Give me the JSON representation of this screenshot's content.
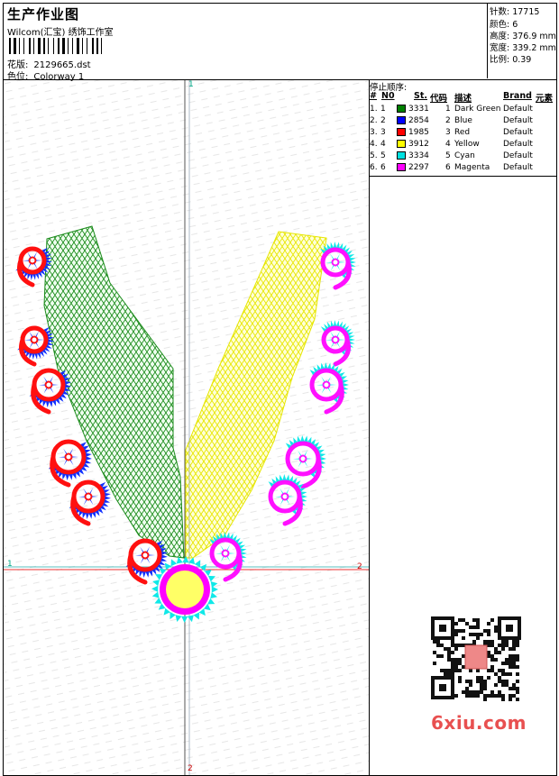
{
  "header": {
    "title": "生产作业图",
    "subtitle": "Wilcom(汇宝) 绣饰工作室",
    "design_label": "花版:",
    "design_value": "2129665.dst",
    "colorway_label": "色位:",
    "colorway_value": "Colorway 1"
  },
  "stats": {
    "stitches_label": "针数:",
    "stitches_value": "17715",
    "colors_label": "颜色:",
    "colors_value": "6",
    "height_label": "高度:",
    "height_value": "376.9 mm",
    "width_label": "宽度:",
    "width_value": "339.2 mm",
    "scale_label": "比例:",
    "scale_value": "0.39"
  },
  "color_table": {
    "title": "停止顺序:",
    "headers": {
      "num": "#",
      "no": "N0",
      "st": "St.",
      "code": "代码",
      "desc": "描述",
      "brand": "Brand",
      "elem": "元素"
    },
    "rows": [
      {
        "num": "1.",
        "no": "1",
        "st": "3331",
        "code": "1",
        "desc": "Dark Green",
        "brand": "Default",
        "color": "#008000"
      },
      {
        "num": "2.",
        "no": "2",
        "st": "2854",
        "code": "2",
        "desc": "Blue",
        "brand": "Default",
        "color": "#0000ff"
      },
      {
        "num": "3.",
        "no": "3",
        "st": "1985",
        "code": "3",
        "desc": "Red",
        "brand": "Default",
        "color": "#ff0000"
      },
      {
        "num": "4.",
        "no": "4",
        "st": "3912",
        "code": "4",
        "desc": "Yellow",
        "brand": "Default",
        "color": "#ffff00"
      },
      {
        "num": "5.",
        "no": "5",
        "st": "3334",
        "code": "5",
        "desc": "Cyan",
        "brand": "Default",
        "color": "#00e0e0"
      },
      {
        "num": "6.",
        "no": "6",
        "st": "2297",
        "code": "6",
        "desc": "Magenta",
        "brand": "Default",
        "color": "#ff00ff"
      }
    ]
  },
  "axes": {
    "top": "1",
    "bottom": "2",
    "left": "1",
    "right": "2"
  },
  "watermark": {
    "text": "6xiu.com"
  }
}
